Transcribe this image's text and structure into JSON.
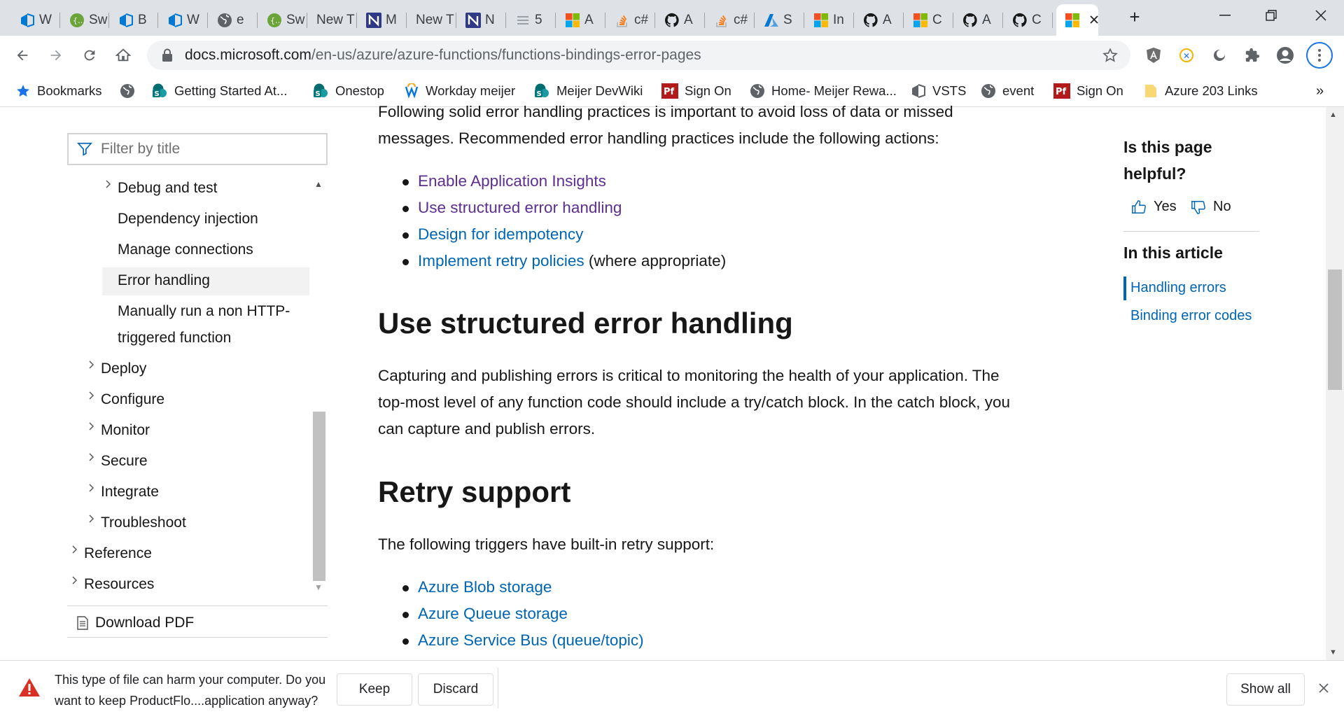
{
  "browser": {
    "tabs": [
      {
        "icon": "azure-devops-icon",
        "label": "W",
        "color": "#0078d4"
      },
      {
        "icon": "swagger-icon",
        "label": "Sw",
        "color": "#6ba539"
      },
      {
        "icon": "azure-devops-icon",
        "label": "B",
        "color": "#0078d4"
      },
      {
        "icon": "azure-devops-icon",
        "label": "W",
        "color": "#0078d4"
      },
      {
        "icon": "globe-icon",
        "label": "e",
        "color": "#5f6368"
      },
      {
        "icon": "swagger-icon",
        "label": "Sw",
        "color": "#6ba539"
      },
      {
        "icon": "none",
        "label": "New T",
        "color": "#5f6368"
      },
      {
        "icon": "nuget-icon",
        "label": "M",
        "color": "#2e3a87"
      },
      {
        "icon": "none",
        "label": "New T",
        "color": "#5f6368"
      },
      {
        "icon": "nuget-icon",
        "label": "N",
        "color": "#2e3a87"
      },
      {
        "icon": "list-icon",
        "label": "5",
        "color": "#9aa0a6"
      },
      {
        "icon": "microsoft-icon",
        "label": "A",
        "color": "#f25022"
      },
      {
        "icon": "stackoverflow-icon",
        "label": "c#",
        "color": "#f48024"
      },
      {
        "icon": "github-icon",
        "label": "A",
        "color": "#171717"
      },
      {
        "icon": "stackoverflow-icon",
        "label": "c#",
        "color": "#f48024"
      },
      {
        "icon": "azure-icon",
        "label": "S",
        "color": "#0078d4"
      },
      {
        "icon": "microsoft-icon",
        "label": "In",
        "color": "#f25022"
      },
      {
        "icon": "github-icon",
        "label": "A",
        "color": "#171717"
      },
      {
        "icon": "microsoft-icon",
        "label": "C",
        "color": "#f25022"
      },
      {
        "icon": "github-icon",
        "label": "A",
        "color": "#171717"
      },
      {
        "icon": "github-icon",
        "label": "C",
        "color": "#171717"
      },
      {
        "icon": "microsoft-icon",
        "label": "",
        "color": "#f25022",
        "active": true
      }
    ],
    "url_host": "docs.microsoft.com",
    "url_path": "/en-us/azure/azure-functions/functions-bindings-error-pages",
    "bookmarks": [
      {
        "icon": "star-icon",
        "label": "Bookmarks"
      },
      {
        "icon": "globe-icon",
        "label": ""
      },
      {
        "icon": "sharepoint-icon",
        "label": "Getting Started At..."
      },
      {
        "icon": "sharepoint-icon",
        "label": "Onestop"
      },
      {
        "icon": "workday-icon",
        "label": "Workday meijer"
      },
      {
        "icon": "sharepoint-icon",
        "label": "Meijer DevWiki"
      },
      {
        "icon": "pf-icon",
        "label": "Sign On"
      },
      {
        "icon": "globe-icon",
        "label": "Home- Meijer Rewa..."
      },
      {
        "icon": "azure-devops-icon",
        "label": "VSTS"
      },
      {
        "icon": "globe-icon",
        "label": "event"
      },
      {
        "icon": "pf-icon",
        "label": "Sign On"
      },
      {
        "icon": "folder-icon",
        "label": "Azure 203 Links"
      }
    ],
    "bookmarks_overflow": "»"
  },
  "nav": {
    "filter_placeholder": "Filter by title",
    "items": [
      {
        "label": "Debug and test",
        "chevron": true
      },
      {
        "label": "Dependency injection",
        "chevron": false
      },
      {
        "label": "Manage connections",
        "chevron": false
      },
      {
        "label": "Error handling",
        "chevron": false,
        "selected": true
      },
      {
        "label": "Manually run a non HTTP-",
        "chevron": false
      },
      {
        "label": "triggered function",
        "chevron": false
      },
      {
        "label": "Deploy",
        "chevron": true
      },
      {
        "label": "Configure",
        "chevron": true
      },
      {
        "label": "Monitor",
        "chevron": true
      },
      {
        "label": "Secure",
        "chevron": true
      },
      {
        "label": "Integrate",
        "chevron": true
      },
      {
        "label": "Troubleshoot",
        "chevron": true
      },
      {
        "label": "Reference",
        "chevron": true
      },
      {
        "label": "Resources",
        "chevron": true
      }
    ],
    "download_pdf": "Download PDF"
  },
  "article": {
    "intro_line1": "Following solid error handling practices is important to avoid loss of data or missed",
    "intro_line2": "messages. Recommended error handling practices include the following actions:",
    "practices": [
      {
        "text": "Enable Application Insights",
        "suffix": ""
      },
      {
        "text": "Use structured error handling",
        "suffix": ""
      },
      {
        "text": "Design for idempotency",
        "suffix": ""
      },
      {
        "text": "Implement retry policies",
        "suffix": " (where appropriate)"
      }
    ],
    "h_structured": "Use structured error handling",
    "structured_p1": "Capturing and publishing errors is critical to monitoring the health of your application. The",
    "structured_p2": "top-most level of any function code should include a try/catch block. In the catch block, you",
    "structured_p3": "can capture and publish errors.",
    "h_retry": "Retry support",
    "retry_p": "The following triggers have built-in retry support:",
    "triggers": [
      "Azure Blob storage",
      "Azure Queue storage",
      "Azure Service Bus (queue/topic)"
    ]
  },
  "rail": {
    "helpful_q1": "Is this page",
    "helpful_q2": "helpful?",
    "yes": "Yes",
    "no": "No",
    "in_this_article": "In this article",
    "toc": [
      "Handling errors",
      "Binding error codes"
    ]
  },
  "download_bar": {
    "warning_line1": "This type of file can harm your computer. Do you",
    "warning_line2": "want to keep ProductFlo....application anyway?",
    "keep": "Keep",
    "discard": "Discard",
    "show_all": "Show all"
  }
}
